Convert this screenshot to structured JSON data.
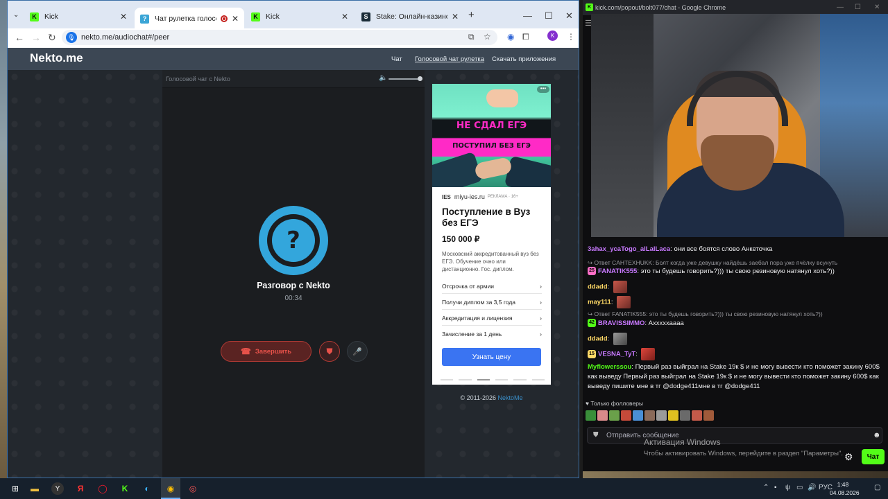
{
  "left_window": {
    "tabs": [
      {
        "label": "Kick",
        "favicon": "kick-icon"
      },
      {
        "label": "Чат рулетка голосовая — ",
        "favicon": "nekto-icon",
        "recording": true
      },
      {
        "label": "Kick",
        "favicon": "kick-icon"
      },
      {
        "label": "Stake: Онлайн-казино и ставк",
        "favicon": "stake-icon"
      }
    ],
    "url": "nekto.me/audiochat#/peer",
    "profile_initial": "K"
  },
  "site": {
    "logo": "Nekto.me",
    "nav": [
      "Чат",
      "Голосовой чат рулетка",
      "Скачать приложения"
    ],
    "call_panel_title": "Голосовой чат с Nekto",
    "volume_level": 1.0,
    "avatar_glyph": "?",
    "talk_title": "Разговор с Nekto",
    "timer": "00:34",
    "end_label": "Завершить",
    "copyright_text": "© 2011-2026 ",
    "copyright_link": "NektoMe"
  },
  "ad": {
    "img_line1": "НЕ СДАЛ ЕГЭ",
    "img_line2": "ПОСТУПИЛ БЕЗ ЕГЭ",
    "logo": "IES",
    "domain": "miyu-ies.ru",
    "tag": "РЕКЛАМА · 16+",
    "title": "Поступление в Вуз без ЕГЭ",
    "price": "150 000 ₽",
    "description": "Московский аккредитованный вуз без ЕГЭ. Обучение очно или дистанционно. Гос. диплом.",
    "links": [
      "Отсрочка от армии",
      "Получи диплом за 3,5 года",
      "Аккредитация и лицензия",
      "Зачисление за 1 день"
    ],
    "cta": "Узнать цену",
    "pages": 6,
    "active_page": 2
  },
  "right_window": {
    "title": "kick.com/popout/bolt077/chat - Google Chrome",
    "messages": [
      {
        "type": "msg",
        "user": "3ahax_ycaTogo_alLalLaca",
        "color": "#c879ff",
        "text": "они все боятся слово Анкеточка"
      },
      {
        "type": "reply",
        "text": "Ответ CAHTEXHUKK: Болт когда уже девушку найдёшь заебал пора уже пчёлку всунуть"
      },
      {
        "type": "msg",
        "user": "FANATIK555",
        "color": "#c879ff",
        "badge": "25",
        "badge_color": "#ff6ec7",
        "text": "это ты будешь говорить?))) ты свою резиновую натянул хоть?))"
      },
      {
        "type": "msg",
        "user": "ddadd",
        "color": "#ffd966",
        "emote": true,
        "text": ""
      },
      {
        "type": "msg",
        "user": "may111",
        "color": "#ffd966",
        "emote": true,
        "text": ""
      },
      {
        "type": "reply",
        "text": "Ответ FANATIK555: это ты будешь говорить?))) ты свою резиновую натянул хоть?))"
      },
      {
        "type": "msg",
        "user": "BRAVISSIMMO",
        "color": "#c879ff",
        "badge": "42",
        "badge_color": "#53fc18",
        "text": "Ахххххаааа"
      },
      {
        "type": "msg",
        "user": "ddadd",
        "color": "#ffd966",
        "emote": true,
        "emote_style": "grey",
        "text": ""
      },
      {
        "type": "msg",
        "user": "VESNA_TyT",
        "color": "#c879ff",
        "badge": "15",
        "badge_color": "#ffd966",
        "emote": true,
        "emote_style": "red",
        "text": ""
      },
      {
        "type": "msg",
        "user": "Myflowerssou",
        "color": "#53fc18",
        "text": "Первый раз выйграл на Stake 19к $ и не могу вывести кто поможет закину 600$ как выведу Первый раз выйграл на Stake 19к $ и не могу вывести кто поможет закину 600$ как выведу пишите мне в тг @dodge411мне в тг @dodge411"
      }
    ],
    "followers_only": "Только фолловеры",
    "input_placeholder": "Отправить сообщение",
    "chat_button": "Чат"
  },
  "windows_watermark": {
    "title": "Активация Windows",
    "subtitle": "Чтобы активировать Windows, перейдите в раздел \"Параметры\"."
  },
  "taskbar": {
    "lang": "РУС",
    "time": "1:48",
    "date": "04.08.2026"
  }
}
